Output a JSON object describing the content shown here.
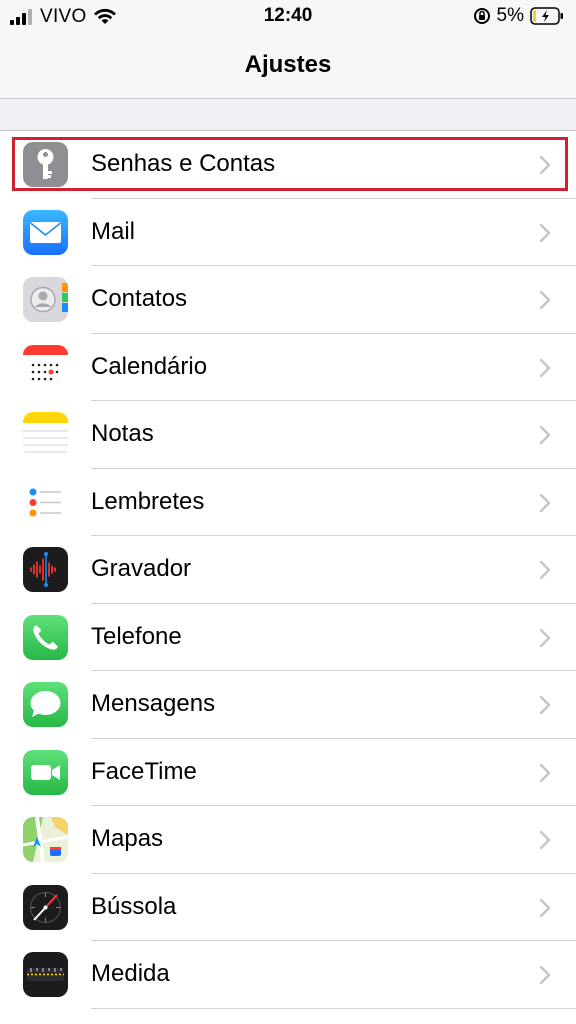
{
  "status_bar": {
    "carrier": "VIVO",
    "time": "12:40",
    "battery_percent": "5%",
    "icons": [
      "signal-icon",
      "wifi-icon",
      "orientation-lock-icon",
      "battery-charging-icon"
    ]
  },
  "nav": {
    "title": "Ajustes"
  },
  "highlight_color": "#d1202f",
  "items": [
    {
      "label": "Senhas e Contas",
      "icon": "key-icon",
      "color": "#8e8e93"
    },
    {
      "label": "Mail",
      "icon": "mail-icon",
      "color": "#1a8cff"
    },
    {
      "label": "Contatos",
      "icon": "contacts-icon",
      "color": "#c7c7cc"
    },
    {
      "label": "Calendário",
      "icon": "calendar-icon",
      "color": "#ff3b30"
    },
    {
      "label": "Notas",
      "icon": "notes-icon",
      "color": "#ffd60a"
    },
    {
      "label": "Lembretes",
      "icon": "reminders-icon",
      "color": "#ffffff"
    },
    {
      "label": "Gravador",
      "icon": "voice-memos-icon",
      "color": "#1c1c1e"
    },
    {
      "label": "Telefone",
      "icon": "phone-icon",
      "color": "#34c759"
    },
    {
      "label": "Mensagens",
      "icon": "messages-icon",
      "color": "#34c759"
    },
    {
      "label": "FaceTime",
      "icon": "facetime-icon",
      "color": "#34c759"
    },
    {
      "label": "Mapas",
      "icon": "maps-icon",
      "color": "#8fd16a"
    },
    {
      "label": "Bússola",
      "icon": "compass-icon",
      "color": "#1c1c1e"
    },
    {
      "label": "Medida",
      "icon": "measure-icon",
      "color": "#1c1c1e"
    }
  ]
}
